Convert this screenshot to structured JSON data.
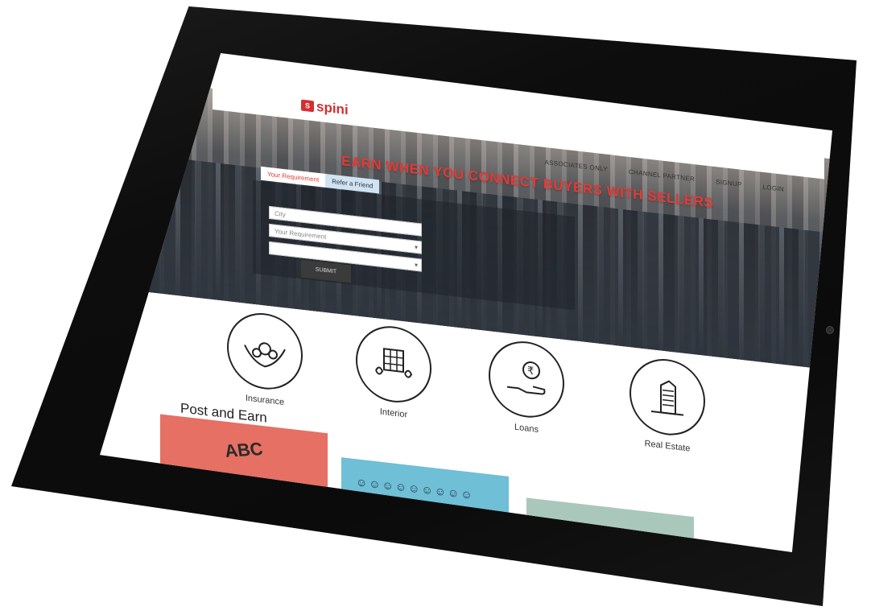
{
  "brand": {
    "logo_text": "spini",
    "logo_mark": "S"
  },
  "nav": {
    "items": [
      "ASSOCIATES ONLY",
      "CHANNEL PARTNER",
      "SIGNUP",
      "LOGIN"
    ]
  },
  "hero": {
    "headline": "EARN WHEN YOU CONNECT BUYERS WITH SELLERS",
    "tabs": [
      {
        "label": "Your Requirement",
        "active": true
      },
      {
        "label": "Refer a Friend",
        "active": false
      }
    ],
    "city_placeholder": "City",
    "requirement_placeholder": "Your Requirement",
    "submit_label": "SUBMIT"
  },
  "categories": [
    {
      "label": "Insurance",
      "icon": "hands-people-icon"
    },
    {
      "label": "Interior",
      "icon": "interior-icon"
    },
    {
      "label": "Loans",
      "icon": "rupee-hand-icon"
    },
    {
      "label": "Real Estate",
      "icon": "building-icon"
    }
  ],
  "post": {
    "title": "Post and Earn"
  },
  "colors": {
    "accent": "#e53935",
    "card1": "#e57063",
    "card2": "#6fbfd6",
    "card3": "#a9c8bb"
  }
}
